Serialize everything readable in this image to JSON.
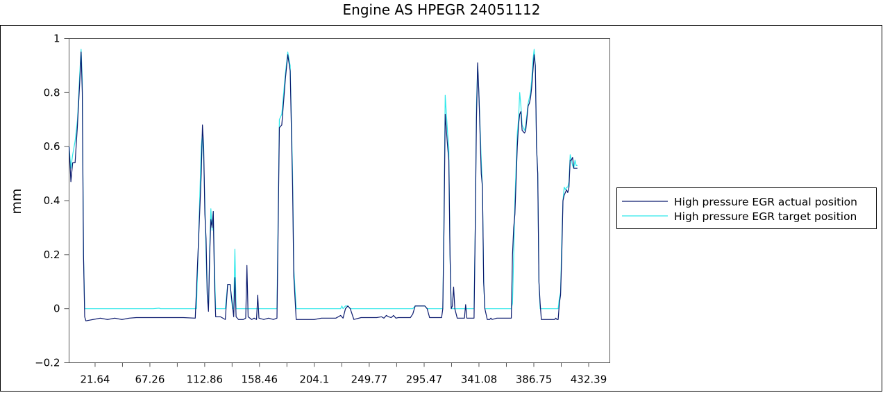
{
  "chart_data": {
    "type": "line",
    "title": "Engine AS  HPEGR 24051112",
    "xlabel": "",
    "ylabel": "mm",
    "xlim": [
      0,
      450
    ],
    "ylim": [
      -0.2,
      1
    ],
    "x_ticks": [
      "21.64",
      "67.26",
      "112.86",
      "158.46",
      "204.1",
      "249.77",
      "295.47",
      "341.08",
      "386.75",
      "432.39"
    ],
    "y_ticks": [
      "−0.2",
      "0",
      "0.2",
      "0.4",
      "0.6",
      "0.8",
      "1"
    ],
    "legend_position": "right",
    "grid": false,
    "series": [
      {
        "name": "High pressure EGR actual position",
        "color": "#0b1a6e",
        "points": [
          [
            0,
            0.6
          ],
          [
            1.5,
            0.47
          ],
          [
            3,
            0.54
          ],
          [
            5,
            0.54
          ],
          [
            7,
            0.68
          ],
          [
            9,
            0.85
          ],
          [
            10,
            0.95
          ],
          [
            11,
            0.8
          ],
          [
            12,
            0.2
          ],
          [
            13,
            -0.03
          ],
          [
            14,
            -0.045
          ],
          [
            20,
            -0.04
          ],
          [
            26,
            -0.035
          ],
          [
            32,
            -0.04
          ],
          [
            38,
            -0.035
          ],
          [
            44,
            -0.04
          ],
          [
            50,
            -0.035
          ],
          [
            56,
            -0.033
          ],
          [
            70,
            -0.033
          ],
          [
            85,
            -0.033
          ],
          [
            95,
            -0.033
          ],
          [
            105,
            -0.035
          ],
          [
            108,
            0.28
          ],
          [
            110,
            0.5
          ],
          [
            111,
            0.68
          ],
          [
            112,
            0.6
          ],
          [
            113,
            0.35
          ],
          [
            114,
            0.26
          ],
          [
            115,
            0.05
          ],
          [
            116,
            -0.01
          ],
          [
            117,
            0.2
          ],
          [
            118,
            0.33
          ],
          [
            119,
            0.3
          ],
          [
            120,
            0.36
          ],
          [
            121,
            0.1
          ],
          [
            122,
            -0.03
          ],
          [
            126,
            -0.03
          ],
          [
            130,
            -0.04
          ],
          [
            132,
            0.09
          ],
          [
            134,
            0.09
          ],
          [
            135,
            0.05
          ],
          [
            137,
            -0.03
          ],
          [
            138,
            0.115
          ],
          [
            139,
            -0.03
          ],
          [
            141,
            -0.04
          ],
          [
            145,
            -0.04
          ],
          [
            147,
            -0.035
          ],
          [
            148,
            0.16
          ],
          [
            149,
            -0.03
          ],
          [
            152,
            -0.04
          ],
          [
            154,
            -0.035
          ],
          [
            156,
            -0.04
          ],
          [
            157,
            0.05
          ],
          [
            158,
            -0.035
          ],
          [
            162,
            -0.04
          ],
          [
            166,
            -0.035
          ],
          [
            170,
            -0.04
          ],
          [
            173,
            -0.035
          ],
          [
            174,
            0.3
          ],
          [
            175,
            0.67
          ],
          [
            177,
            0.68
          ],
          [
            180,
            0.85
          ],
          [
            182,
            0.94
          ],
          [
            184,
            0.88
          ],
          [
            186,
            0.45
          ],
          [
            187,
            0.12
          ],
          [
            189,
            -0.04
          ],
          [
            195,
            -0.04
          ],
          [
            200,
            -0.04
          ],
          [
            204,
            -0.04
          ],
          [
            210,
            -0.035
          ],
          [
            216,
            -0.035
          ],
          [
            222,
            -0.035
          ],
          [
            226,
            -0.025
          ],
          [
            228,
            -0.035
          ],
          [
            230,
            0.0
          ],
          [
            232,
            0.01
          ],
          [
            234,
            0.0
          ],
          [
            237,
            -0.04
          ],
          [
            243,
            -0.033
          ],
          [
            250,
            -0.033
          ],
          [
            256,
            -0.033
          ],
          [
            260,
            -0.03
          ],
          [
            262,
            -0.035
          ],
          [
            264,
            -0.025
          ],
          [
            266,
            -0.03
          ],
          [
            268,
            -0.033
          ],
          [
            270,
            -0.025
          ],
          [
            272,
            -0.035
          ],
          [
            274,
            -0.033
          ],
          [
            280,
            -0.033
          ],
          [
            284,
            -0.033
          ],
          [
            286,
            -0.02
          ],
          [
            288,
            0.01
          ],
          [
            292,
            0.01
          ],
          [
            296,
            0.01
          ],
          [
            298,
            0.0
          ],
          [
            300,
            -0.033
          ],
          [
            304,
            -0.033
          ],
          [
            308,
            -0.033
          ],
          [
            310,
            -0.033
          ],
          [
            311,
            0.0
          ],
          [
            312,
            0.3
          ],
          [
            313,
            0.72
          ],
          [
            315,
            0.6
          ],
          [
            316,
            0.55
          ],
          [
            317,
            0.2
          ],
          [
            318,
            0.0
          ],
          [
            319,
            0.01
          ],
          [
            320,
            0.08
          ],
          [
            321,
            0.0
          ],
          [
            323,
            -0.035
          ],
          [
            326,
            -0.035
          ],
          [
            329,
            -0.035
          ],
          [
            330,
            0.015
          ],
          [
            331,
            -0.035
          ],
          [
            335,
            -0.035
          ],
          [
            337,
            -0.035
          ],
          [
            338,
            0.3
          ],
          [
            339,
            0.7
          ],
          [
            340,
            0.91
          ],
          [
            341,
            0.8
          ],
          [
            343,
            0.5
          ],
          [
            344,
            0.45
          ],
          [
            345,
            0.1
          ],
          [
            346,
            0.0
          ],
          [
            348,
            -0.04
          ],
          [
            350,
            -0.04
          ],
          [
            351,
            -0.035
          ],
          [
            352,
            -0.04
          ],
          [
            356,
            -0.035
          ],
          [
            360,
            -0.035
          ],
          [
            364,
            -0.035
          ],
          [
            368,
            -0.035
          ],
          [
            369,
            0.2
          ],
          [
            370,
            0.3
          ],
          [
            371,
            0.35
          ],
          [
            373,
            0.6
          ],
          [
            374,
            0.68
          ],
          [
            375,
            0.72
          ],
          [
            376,
            0.73
          ],
          [
            377,
            0.66
          ],
          [
            379,
            0.65
          ],
          [
            380,
            0.66
          ],
          [
            382,
            0.75
          ],
          [
            383,
            0.76
          ],
          [
            384,
            0.78
          ],
          [
            385,
            0.82
          ],
          [
            386,
            0.88
          ],
          [
            387,
            0.94
          ],
          [
            388,
            0.9
          ],
          [
            389,
            0.6
          ],
          [
            390,
            0.5
          ],
          [
            391,
            0.1
          ],
          [
            392,
            0.02
          ],
          [
            393,
            -0.04
          ],
          [
            396,
            -0.04
          ],
          [
            400,
            -0.04
          ],
          [
            404,
            -0.04
          ],
          [
            405,
            -0.035
          ],
          [
            406,
            -0.04
          ],
          [
            407,
            -0.04
          ],
          [
            408,
            0.02
          ],
          [
            409,
            0.05
          ],
          [
            410,
            0.2
          ],
          [
            411,
            0.4
          ],
          [
            412,
            0.42
          ],
          [
            413,
            0.43
          ],
          [
            414,
            0.44
          ],
          [
            415,
            0.43
          ],
          [
            416,
            0.45
          ],
          [
            417,
            0.55
          ],
          [
            418,
            0.55
          ],
          [
            419,
            0.56
          ],
          [
            420,
            0.52
          ],
          [
            421,
            0.52
          ],
          [
            422,
            0.52
          ],
          [
            423,
            0.52
          ]
        ]
      },
      {
        "name": "High pressure EGR target position",
        "color": "#2ee8ea",
        "points": [
          [
            0,
            0.6
          ],
          [
            1.5,
            0.52
          ],
          [
            3,
            0.57
          ],
          [
            5,
            0.62
          ],
          [
            7,
            0.7
          ],
          [
            9,
            0.88
          ],
          [
            10,
            0.96
          ],
          [
            11,
            0.85
          ],
          [
            12,
            0.2
          ],
          [
            13,
            0.0
          ],
          [
            20,
            0.0
          ],
          [
            40,
            0.0
          ],
          [
            70,
            0.0
          ],
          [
            75,
            0.002
          ],
          [
            76,
            0.0
          ],
          [
            105,
            0.0
          ],
          [
            106,
            0.0
          ],
          [
            108,
            0.3
          ],
          [
            110,
            0.6
          ],
          [
            111,
            0.65
          ],
          [
            112,
            0.55
          ],
          [
            113,
            0.4
          ],
          [
            114,
            0.2
          ],
          [
            115,
            0.05
          ],
          [
            116,
            0.0
          ],
          [
            117,
            0.22
          ],
          [
            118,
            0.37
          ],
          [
            119,
            0.29
          ],
          [
            120,
            0.36
          ],
          [
            121,
            0.15
          ],
          [
            122,
            0.0
          ],
          [
            130,
            0.0
          ],
          [
            132,
            0.09
          ],
          [
            134,
            0.09
          ],
          [
            135,
            0.04
          ],
          [
            136,
            0.0
          ],
          [
            137,
            0.0
          ],
          [
            138,
            0.22
          ],
          [
            139,
            0.0
          ],
          [
            148,
            0.0
          ],
          [
            149,
            0.0
          ],
          [
            173,
            0.0
          ],
          [
            174,
            0.35
          ],
          [
            175,
            0.7
          ],
          [
            177,
            0.72
          ],
          [
            180,
            0.87
          ],
          [
            182,
            0.95
          ],
          [
            184,
            0.9
          ],
          [
            186,
            0.5
          ],
          [
            187,
            0.15
          ],
          [
            189,
            0.0
          ],
          [
            226,
            0.0
          ],
          [
            227,
            0.01
          ],
          [
            228,
            0.0
          ],
          [
            230,
            0.01
          ],
          [
            232,
            0.01
          ],
          [
            234,
            0.0
          ],
          [
            286,
            0.0
          ],
          [
            288,
            0.01
          ],
          [
            292,
            0.01
          ],
          [
            296,
            0.01
          ],
          [
            298,
            0.0
          ],
          [
            310,
            0.0
          ],
          [
            311,
            0.0
          ],
          [
            312,
            0.35
          ],
          [
            313,
            0.79
          ],
          [
            315,
            0.65
          ],
          [
            316,
            0.6
          ],
          [
            317,
            0.2
          ],
          [
            318,
            0.0
          ],
          [
            337,
            0.0
          ],
          [
            338,
            0.3
          ],
          [
            339,
            0.75
          ],
          [
            340,
            0.9
          ],
          [
            341,
            0.8
          ],
          [
            343,
            0.55
          ],
          [
            344,
            0.45
          ],
          [
            345,
            0.1
          ],
          [
            346,
            0.0
          ],
          [
            368,
            0.0
          ],
          [
            369,
            0.02
          ],
          [
            370,
            0.2
          ],
          [
            371,
            0.4
          ],
          [
            373,
            0.65
          ],
          [
            374,
            0.7
          ],
          [
            375,
            0.8
          ],
          [
            376,
            0.75
          ],
          [
            377,
            0.68
          ],
          [
            379,
            0.66
          ],
          [
            380,
            0.68
          ],
          [
            382,
            0.76
          ],
          [
            383,
            0.78
          ],
          [
            384,
            0.8
          ],
          [
            385,
            0.85
          ],
          [
            386,
            0.92
          ],
          [
            387,
            0.96
          ],
          [
            388,
            0.9
          ],
          [
            389,
            0.6
          ],
          [
            390,
            0.5
          ],
          [
            391,
            0.1
          ],
          [
            392,
            0.0
          ],
          [
            407,
            0.0
          ],
          [
            408,
            0.04
          ],
          [
            409,
            0.06
          ],
          [
            410,
            0.25
          ],
          [
            411,
            0.4
          ],
          [
            412,
            0.45
          ],
          [
            413,
            0.44
          ],
          [
            414,
            0.45
          ],
          [
            415,
            0.45
          ],
          [
            416,
            0.47
          ],
          [
            417,
            0.57
          ],
          [
            418,
            0.55
          ],
          [
            419,
            0.53
          ],
          [
            420,
            0.52
          ],
          [
            421,
            0.55
          ],
          [
            422,
            0.53
          ],
          [
            423,
            0.53
          ]
        ]
      }
    ]
  }
}
